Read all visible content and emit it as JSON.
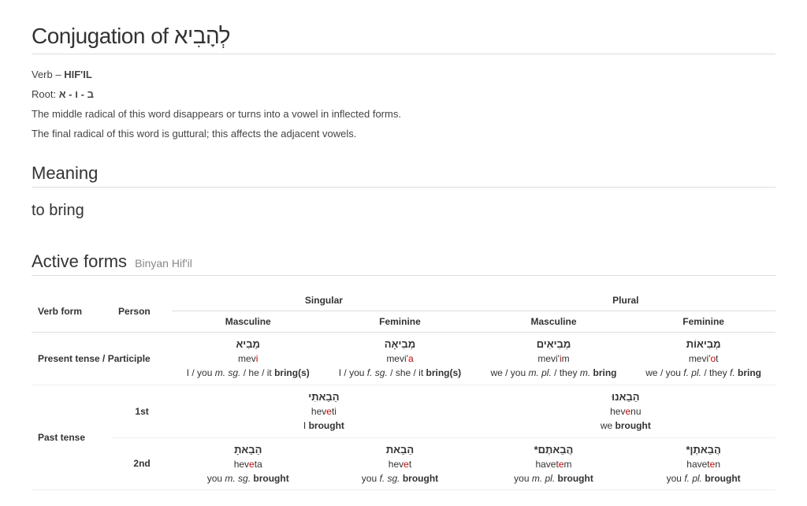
{
  "title_prefix": "Conjugation of ",
  "title_hebrew": "לְהָבִיא",
  "verb_label": "Verb – ",
  "verb_binyan": "HIF'IL",
  "root_label": "Root: ",
  "root_value": "ב - ו - א",
  "note1": "The middle radical of this word disappears or turns into a vowel in inflected forms.",
  "note2": "The final radical of this word is guttural; this affects the adjacent vowels.",
  "meaning_heading": "Meaning",
  "meaning": "to bring",
  "active_heading": "Active forms",
  "active_sub": "Binyan Hif'il",
  "headers": {
    "verb_form": "Verb form",
    "person": "Person",
    "singular": "Singular",
    "plural": "Plural",
    "masc": "Masculine",
    "fem": "Feminine"
  },
  "rows": {
    "present_label": "Present tense / Participle",
    "past_label": "Past tense",
    "person1": "1st",
    "person2": "2nd"
  },
  "present": {
    "ms": {
      "he": "מֵבִיא",
      "tr_pre": "mev",
      "tr_stress": "i",
      "tr_post": "",
      "gl_pre": "I / you ",
      "gl_it1": "m. sg.",
      "gl_mid": " / he / it ",
      "gl_b": "bring(s)"
    },
    "fs": {
      "he": "מְבִיאָה",
      "tr_pre": "mevi'",
      "tr_stress": "a",
      "tr_post": "",
      "gl_pre": "I / you ",
      "gl_it1": "f. sg.",
      "gl_mid": " / she / it ",
      "gl_b": "bring(s)"
    },
    "mp": {
      "he": "מְבִיאִים",
      "tr_pre": "mevi'",
      "tr_stress": "i",
      "tr_post": "m",
      "gl_pre": "we / you ",
      "gl_it1": "m. pl.",
      "gl_mid": " / they ",
      "gl_it2": "m.",
      "gl_b": " bring"
    },
    "fp": {
      "he": "מְבִיאוֹת",
      "tr_pre": "mevi'",
      "tr_stress": "o",
      "tr_post": "t",
      "gl_pre": "we / you ",
      "gl_it1": "f. pl.",
      "gl_mid": " / they ",
      "gl_it2": "f.",
      "gl_b": " bring"
    }
  },
  "past1": {
    "sg": {
      "he": "הֵבֵאתִי",
      "tr_pre": "hev",
      "tr_stress": "e",
      "tr_post": "ti",
      "gl_pre": "I ",
      "gl_b": "brought"
    },
    "pl": {
      "he": "הֵבֵאנוּ",
      "tr_pre": "hev",
      "tr_stress": "e",
      "tr_post": "nu",
      "gl_pre": "we ",
      "gl_b": "brought"
    }
  },
  "past2": {
    "ms": {
      "he": "הֵבֵאתָ",
      "tr_pre": "hev",
      "tr_stress": "e",
      "tr_post": "ta",
      "gl_pre": "you ",
      "gl_it1": "m. sg.",
      "gl_b": " brought"
    },
    "fs": {
      "he": "הֵבֵאת",
      "tr_pre": "hev",
      "tr_stress": "e",
      "tr_post": "t",
      "gl_pre": "you ",
      "gl_it1": "f. sg.",
      "gl_b": " brought"
    },
    "mp": {
      "he": "הֲבֵאתֶם*",
      "tr_pre": "havet",
      "tr_stress": "e",
      "tr_post": "m",
      "gl_pre": "you ",
      "gl_it1": "m. pl.",
      "gl_b": " brought"
    },
    "fp": {
      "he": "הֲבֵאתֶן*",
      "tr_pre": "havet",
      "tr_stress": "e",
      "tr_post": "n",
      "gl_pre": "you ",
      "gl_it1": "f. pl.",
      "gl_b": " brought"
    }
  }
}
